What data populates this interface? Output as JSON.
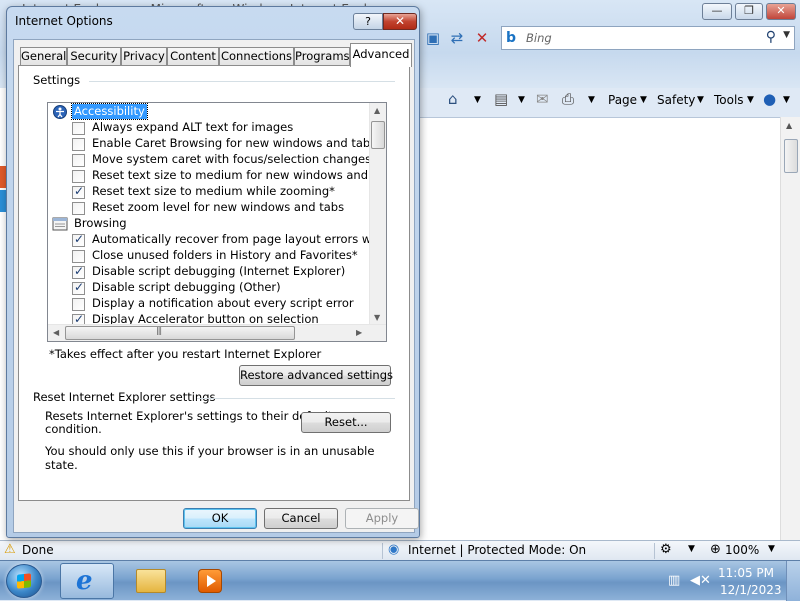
{
  "browser": {
    "window_title": "Internet Explorer - ... Microsoft ... - Windows Internet Explorer",
    "search_placeholder": "Bing",
    "commands": {
      "page": "Page",
      "safety": "Safety",
      "tools": "Tools"
    },
    "status": {
      "text": "Done",
      "zone": "Internet | Protected Mode: On",
      "zoom": "100%"
    }
  },
  "dialog": {
    "title": "Internet Options",
    "help_label": "?",
    "close_label": "✕",
    "tabs": [
      "General",
      "Security",
      "Privacy",
      "Content",
      "Connections",
      "Programs",
      "Advanced"
    ],
    "active_tab": "Advanced",
    "settings_label": "Settings",
    "categories": [
      {
        "label": "Accessibility",
        "icon": "accessibility-icon",
        "selected": true,
        "options": [
          {
            "label": "Always expand ALT text for images",
            "checked": false
          },
          {
            "label": "Enable Caret Browsing for new windows and tabs",
            "checked": false
          },
          {
            "label": "Move system caret with focus/selection changes",
            "checked": false
          },
          {
            "label": "Reset text size to medium for new windows and tabs",
            "checked": false
          },
          {
            "label": "Reset text size to medium while zooming*",
            "checked": true
          },
          {
            "label": "Reset zoom level for new windows and tabs",
            "checked": false
          }
        ]
      },
      {
        "label": "Browsing",
        "icon": "browsing-icon",
        "selected": false,
        "options": [
          {
            "label": "Automatically recover from page layout errors with Compa",
            "checked": true
          },
          {
            "label": "Close unused folders in History and Favorites*",
            "checked": false
          },
          {
            "label": "Disable script debugging (Internet Explorer)",
            "checked": true
          },
          {
            "label": "Disable script debugging (Other)",
            "checked": true
          },
          {
            "label": "Display a notification about every script error",
            "checked": false
          },
          {
            "label": "Display Accelerator button on selection",
            "checked": true
          }
        ]
      }
    ],
    "restart_note": "*Takes effect after you restart Internet Explorer",
    "restore_button": "Restore advanced settings",
    "reset_group_label": "Reset Internet Explorer settings",
    "reset_desc_line1": "Resets Internet Explorer's settings to their default",
    "reset_desc_line2": "condition.",
    "reset_button": "Reset...",
    "reset_warning": "You should only use this if your browser is in an unusable state.",
    "ok_button": "OK",
    "cancel_button": "Cancel",
    "apply_button": "Apply"
  },
  "taskbar": {
    "time": "11:05 PM",
    "date": "12/1/2023"
  }
}
